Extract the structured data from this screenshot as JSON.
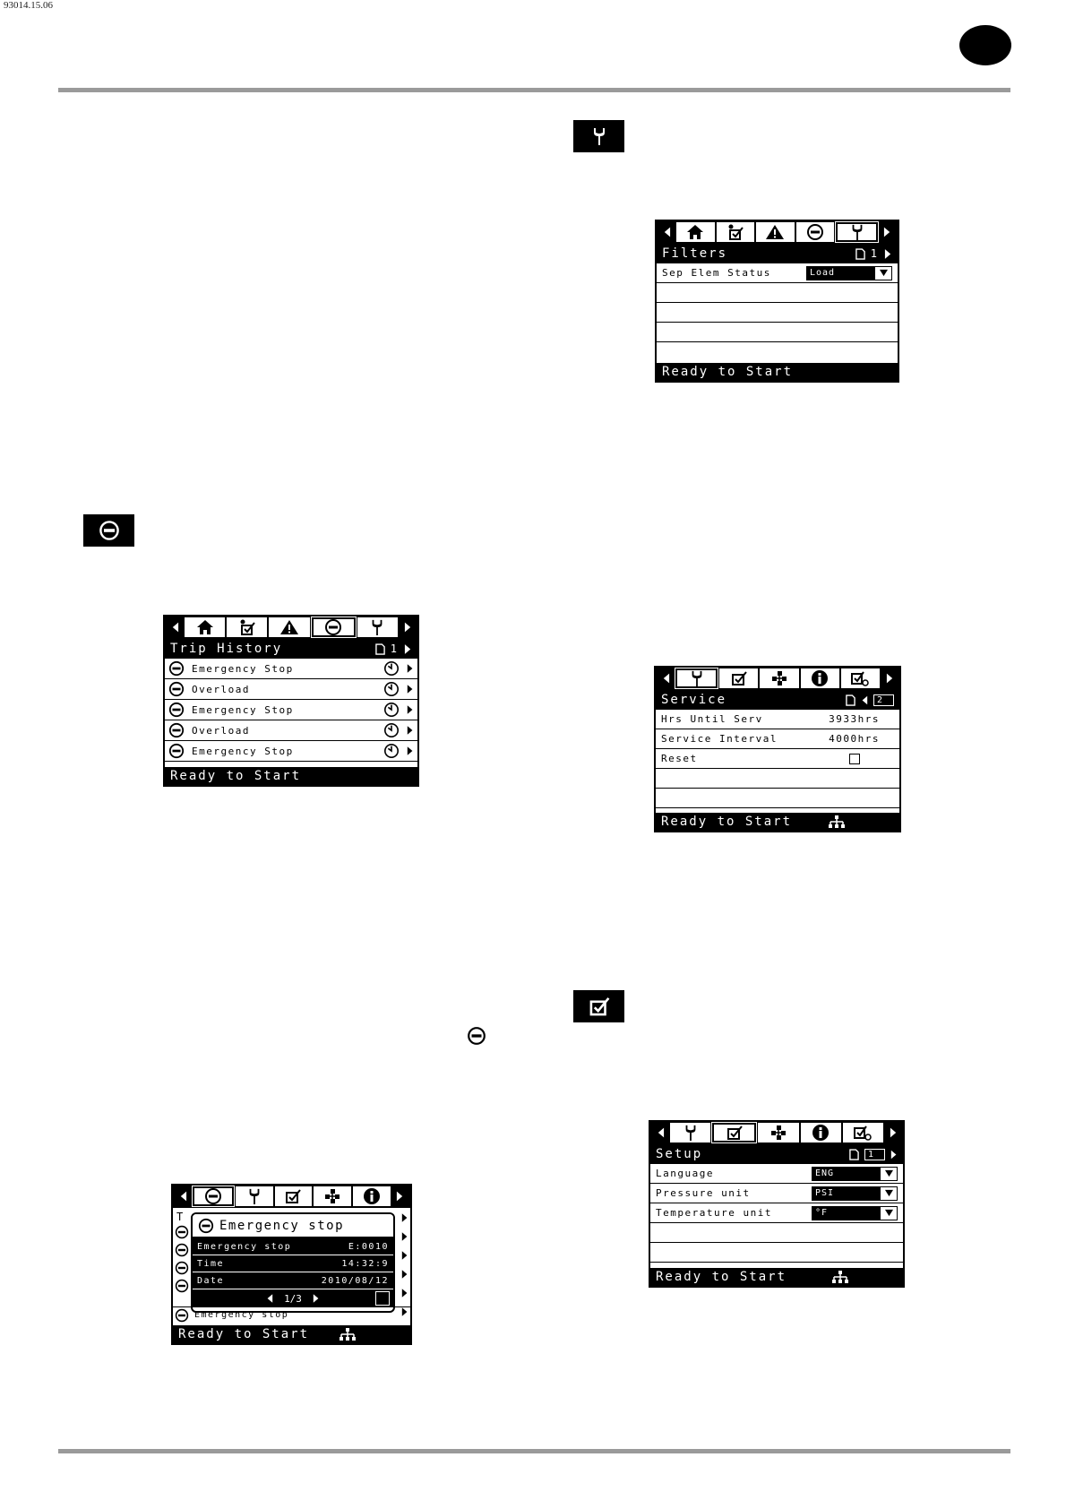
{
  "header": {
    "doc_code": "93014.15.06"
  },
  "filters_screen": {
    "title": "Filters",
    "page": "1",
    "rows": [
      {
        "label": "Sep Elem Status",
        "value": "Load"
      }
    ],
    "status": "Ready to Start"
  },
  "trip_history_screen": {
    "title": "Trip History",
    "page": "1",
    "rows": [
      {
        "label": "Emergency Stop"
      },
      {
        "label": "Overload"
      },
      {
        "label": "Emergency Stop"
      },
      {
        "label": "Overload"
      },
      {
        "label": "Emergency Stop"
      }
    ],
    "status": "Ready to Start"
  },
  "service_screen": {
    "title": "Service",
    "page": "2",
    "rows": [
      {
        "label": "Hrs Until Serv",
        "value": "3933hrs"
      },
      {
        "label": "Service Interval",
        "value": "4000hrs"
      },
      {
        "label": "Reset",
        "value": ""
      }
    ],
    "status": "Ready to Start"
  },
  "trip_detail_screen": {
    "popup_title": "Emergency stop",
    "rows": [
      {
        "label": "Emergency stop",
        "value": "E:0010"
      },
      {
        "label": "Time",
        "value": "14:32:9"
      },
      {
        "label": "Date",
        "value": "2010/08/12"
      }
    ],
    "pager": "1/3",
    "background_row": "Emergency stop",
    "background_title_initial": "T",
    "status": "Ready to Start"
  },
  "setup_screen": {
    "title": "Setup",
    "page": "1",
    "rows": [
      {
        "label": "Language",
        "value": "ENG"
      },
      {
        "label": "Pressure unit",
        "value": "PSI"
      },
      {
        "label": "Temperature unit",
        "value": "°F"
      }
    ],
    "status": "Ready to Start"
  }
}
